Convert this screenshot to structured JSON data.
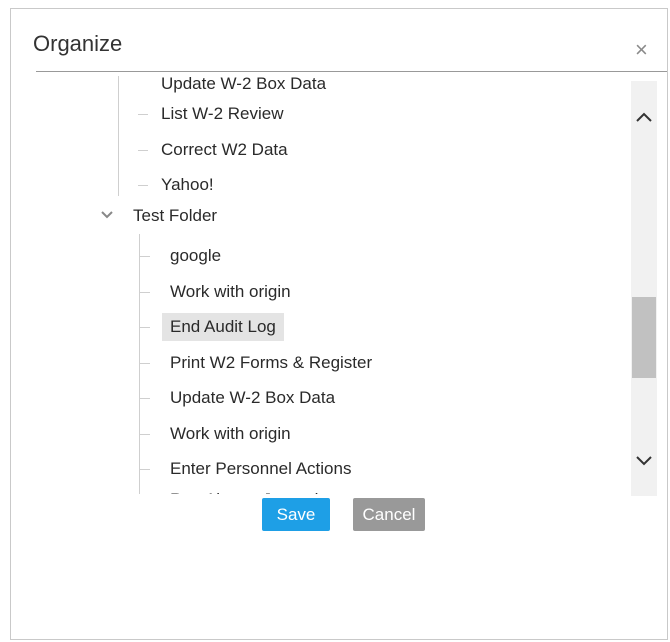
{
  "dialog": {
    "title": "Organize",
    "close_glyph": "×"
  },
  "tree": {
    "partial_top_label": "Update W-2 Box Data",
    "group1_items": [
      "List W-2 Review",
      "Correct W2 Data",
      "Yahoo!"
    ],
    "folder": {
      "label": "Test Folder",
      "expanded": true,
      "items": [
        {
          "label": "google",
          "selected": false
        },
        {
          "label": "Work with origin",
          "selected": false
        },
        {
          "label": "End Audit Log",
          "selected": true
        },
        {
          "label": "Print W2 Forms & Register",
          "selected": false
        },
        {
          "label": "Update W-2 Box Data",
          "selected": false
        },
        {
          "label": "Work with origin",
          "selected": false
        },
        {
          "label": "Enter Personnel Actions",
          "selected": false
        }
      ],
      "partial_bottom_label": "Run Absent Journal"
    }
  },
  "buttons": {
    "save": "Save",
    "cancel": "Cancel"
  },
  "colors": {
    "save_bg": "#1e9fe6",
    "cancel_bg": "#999999",
    "selected_bg": "#e4e4e4"
  },
  "icons": {
    "close": "close-icon",
    "folder_toggle": "chevron-down-icon",
    "scroll_up": "chevron-up-icon",
    "scroll_down": "chevron-down-icon"
  }
}
